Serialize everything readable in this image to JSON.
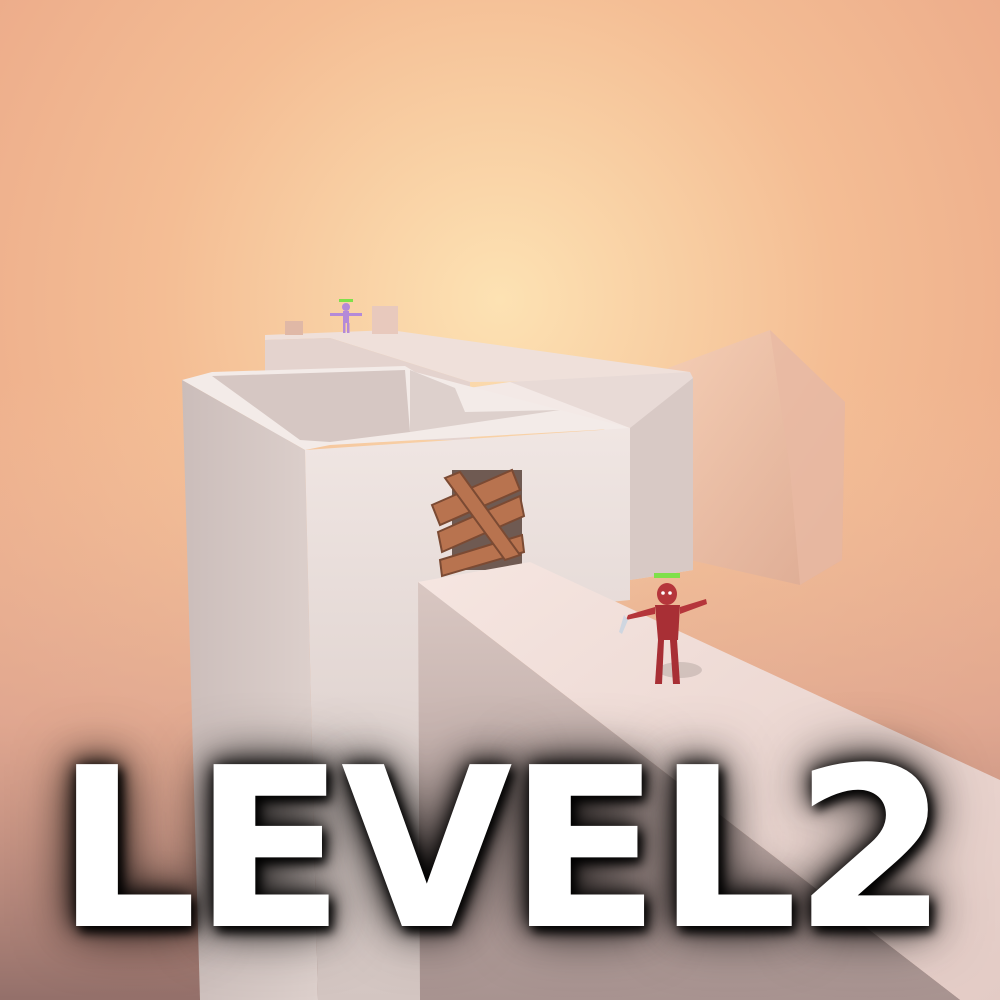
{
  "hud": {
    "level_label": "LEVEL2"
  },
  "scene": {
    "sky_top_color": "#f3b58f",
    "sky_bottom_color": "#c9978c",
    "wall_color": "#ece0dc",
    "player_color": "#b5363b",
    "enemy_color": "#b48ad8",
    "health_bar_color": "#7fe04a",
    "plank_color": "#b8734f"
  }
}
